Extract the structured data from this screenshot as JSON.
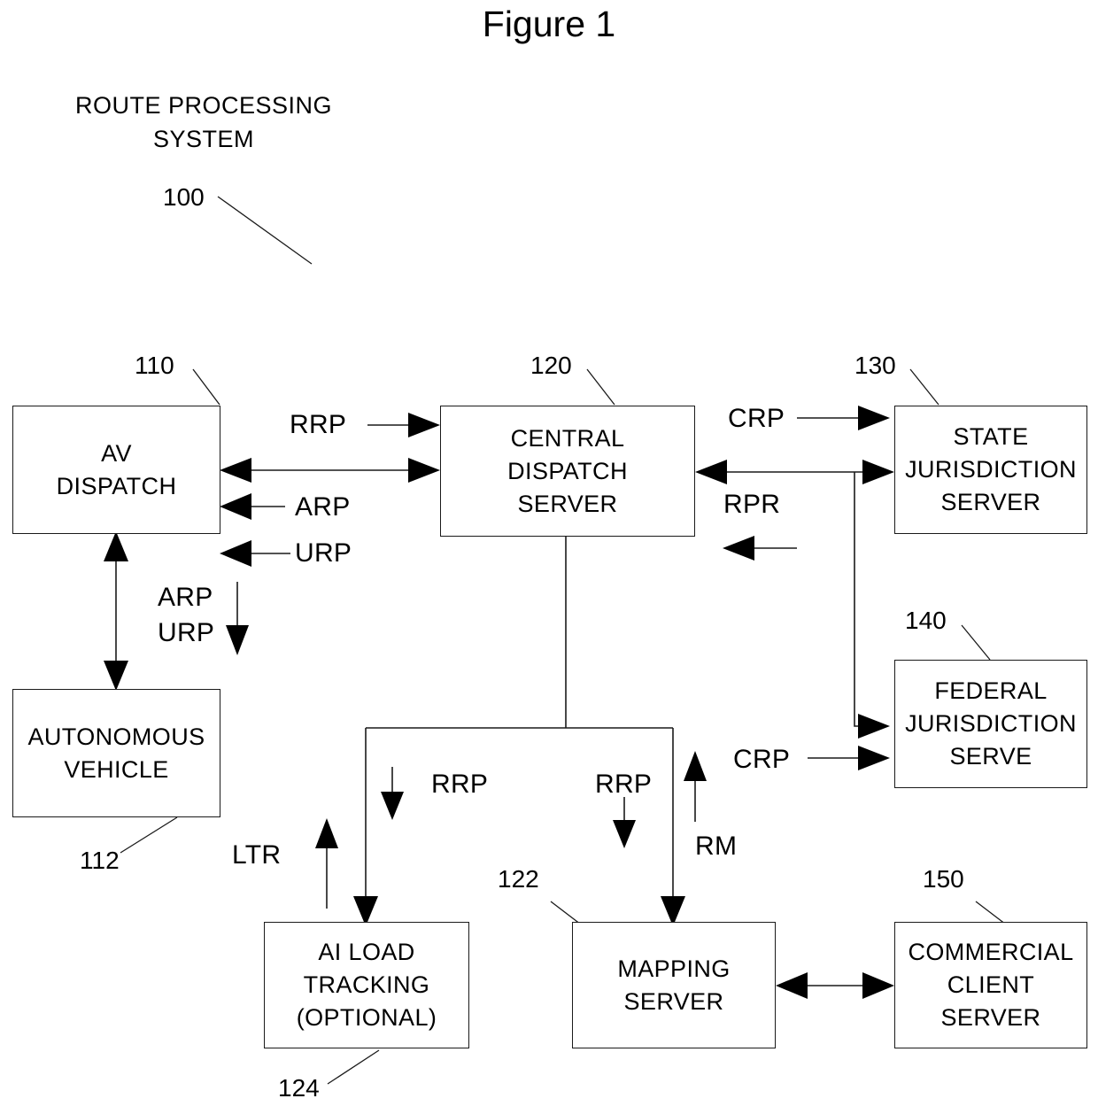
{
  "figure": {
    "title": "Figure 1",
    "system_label": "ROUTE PROCESSING\nSYSTEM",
    "system_ref": "100"
  },
  "nodes": [
    {
      "id": "av-dispatch",
      "label": "AV\nDISPATCH",
      "ref": "110"
    },
    {
      "id": "autonomous-vehicle",
      "label": "AUTONOMOUS\nVEHICLE",
      "ref": "112"
    },
    {
      "id": "central-dispatch-server",
      "label": "CENTRAL\nDISPATCH\nSERVER",
      "ref": "120"
    },
    {
      "id": "state-jurisdiction",
      "label": "STATE\nJURISDICTION\nSERVER",
      "ref": "130"
    },
    {
      "id": "federal-jurisdiction",
      "label": "FEDERAL\nJURISDICTION\nSERVE",
      "ref": "140"
    },
    {
      "id": "ai-load-tracking",
      "label": "AI LOAD\nTRACKING\n(OPTIONAL)",
      "ref": "124"
    },
    {
      "id": "mapping-server",
      "label": "MAPPING\nSERVER",
      "ref": "122"
    },
    {
      "id": "commercial-client",
      "label": "COMMERCIAL\nCLIENT\nSERVER",
      "ref": "150"
    }
  ],
  "signals": [
    {
      "id": "rrp-av-to-cds",
      "label": "RRP"
    },
    {
      "id": "arp-cds-to-av",
      "label": "ARP"
    },
    {
      "id": "urp-cds-to-av",
      "label": "URP"
    },
    {
      "id": "arp-av-to-vehicle",
      "label": "ARP"
    },
    {
      "id": "urp-av-to-vehicle",
      "label": "URP"
    },
    {
      "id": "crp-cds-to-state",
      "label": "CRP"
    },
    {
      "id": "rpr-state-to-cds",
      "label": "RPR"
    },
    {
      "id": "crp-cds-to-federal",
      "label": "CRP"
    },
    {
      "id": "rrp-cds-to-aiload",
      "label": "RRP"
    },
    {
      "id": "ltr-aiload-to-cds",
      "label": "LTR"
    },
    {
      "id": "rrp-cds-to-mapping",
      "label": "RRP"
    },
    {
      "id": "rm-mapping-to-cds",
      "label": "RM"
    }
  ],
  "colors": {
    "ink": "#1a1a1a",
    "background": "#ffffff"
  }
}
